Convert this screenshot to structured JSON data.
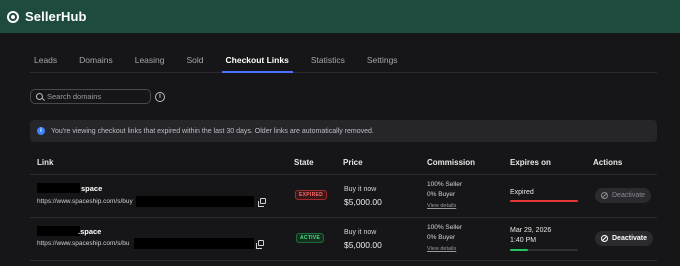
{
  "app": {
    "brand": "SellerHub"
  },
  "tabs": [
    {
      "label": "Leads"
    },
    {
      "label": "Domains"
    },
    {
      "label": "Leasing"
    },
    {
      "label": "Sold"
    },
    {
      "label": "Checkout Links",
      "active": true
    },
    {
      "label": "Statistics"
    },
    {
      "label": "Settings"
    }
  ],
  "search": {
    "placeholder": "Search domains",
    "value": ""
  },
  "info_icon_glyph": "i",
  "banner": {
    "icon": "i",
    "text": "You're viewing checkout links that expired within the last 30 days. Older links are automatically removed."
  },
  "table": {
    "headers": {
      "link": "Link",
      "state": "State",
      "price": "Price",
      "commission": "Commission",
      "expires": "Expires on",
      "actions": "Actions"
    },
    "rows": [
      {
        "domain_suffix": "space",
        "url_prefix": "https://www.spaceship.com/s/buy",
        "state": "EXPIRED",
        "price_label": "Buy it now",
        "price_value": "$5,000.00",
        "commission_seller": "100% Seller",
        "commission_buyer": "0% Buyer",
        "view_details": "View details",
        "expires_text": "Expired",
        "expires_time": "",
        "expires_progress": 1.0,
        "progress_color": "#e5383b",
        "action": "Deactivate",
        "action_enabled": false
      },
      {
        "domain_suffix": ".space",
        "url_prefix": "https://www.spaceship.com/s/bu",
        "state": "ACTIVE",
        "price_label": "Buy it now",
        "price_value": "$5,000.00",
        "commission_seller": "100% Seller",
        "commission_buyer": "0% Buyer",
        "view_details": "View details",
        "expires_text": "Mar 29, 2026",
        "expires_time": "1:40 PM",
        "expires_progress": 0.27,
        "progress_color": "#22c55e",
        "action": "Deactivate",
        "action_enabled": true
      }
    ]
  },
  "colors": {
    "header_bg": "#1f4a3e",
    "accent": "#4b73ff",
    "expired": "#e5383b",
    "active": "#22c55e"
  }
}
